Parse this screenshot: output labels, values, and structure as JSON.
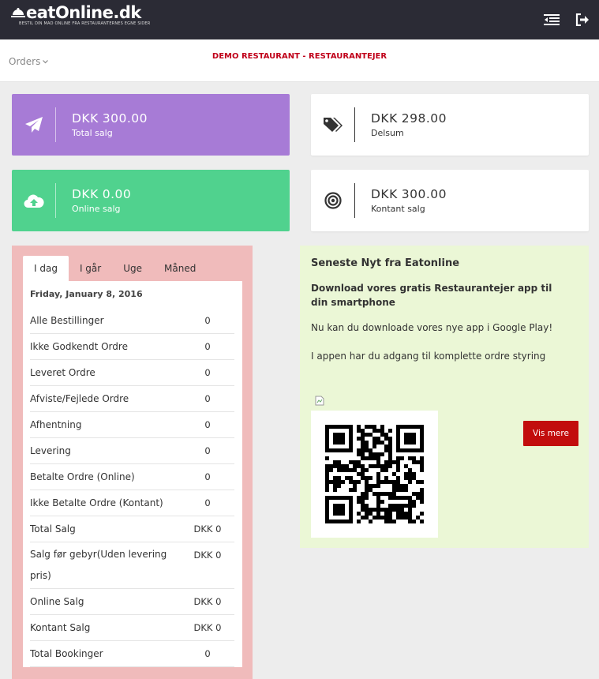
{
  "brand": {
    "logo_text": "eatOnline.dk",
    "tagline": "BESTIL DIN MAD ONLINE FRA RESTAURANTERNES EGNE SIDER"
  },
  "header": {
    "orders_label": "Orders",
    "restaurant": "DEMO RESTAURANT - RESTAURANTEJER",
    "icons": [
      "menu-toggle-icon",
      "logout-icon"
    ]
  },
  "stats": [
    {
      "currency": "DKK",
      "amount": "300.00",
      "label": "Total salg",
      "icon": "paper-plane-icon",
      "color": "#a77bd6"
    },
    {
      "currency": "DKK",
      "amount": "298.00",
      "label": "Delsum",
      "icon": "tags-icon",
      "color": "#ffffff"
    },
    {
      "currency": "DKK",
      "amount": "0.00",
      "label": "Online salg",
      "icon": "cloud-upload-icon",
      "color": "#50d28e"
    },
    {
      "currency": "DKK",
      "amount": "300.00",
      "label": "Kontant salg",
      "icon": "bullseye-icon",
      "color": "#ffffff"
    }
  ],
  "report": {
    "tabs": [
      "I dag",
      "I går",
      "Uge",
      "Måned"
    ],
    "active_tab": "I dag",
    "date": "Friday, January 8, 2016",
    "rows": [
      {
        "label": "Alle Bestillinger",
        "value": "0"
      },
      {
        "label": "Ikke Godkendt Ordre",
        "value": "0"
      },
      {
        "label": "Leveret Ordre",
        "value": "0"
      },
      {
        "label": "Afviste/Fejlede Ordre",
        "value": "0"
      },
      {
        "label": "Afhentning",
        "value": "0"
      },
      {
        "label": "Levering",
        "value": "0"
      },
      {
        "label": "Betalte Ordre (Online)",
        "value": "0"
      },
      {
        "label": "Ikke Betalte Ordre (Kontant)",
        "value": "0"
      },
      {
        "label": "Total Salg",
        "value": "DKK 0"
      },
      {
        "label": "Salg før gebyr(Uden levering pris)",
        "value": "DKK 0"
      },
      {
        "label": "Online Salg",
        "value": "DKK 0"
      },
      {
        "label": "Kontant Salg",
        "value": "DKK 0"
      },
      {
        "label": "Total Bookinger",
        "value": "0"
      }
    ]
  },
  "news": {
    "title": "Seneste Nyt fra Eatonline",
    "headline": "Download vores gratis Restaurantejer app til din smartphone",
    "p1": "Nu kan du downloade vores nye app i Google Play!",
    "p2": "I appen har du adgang til komplette ordre styring",
    "button": "Vis mere"
  },
  "colors": {
    "topbar": "#2b2b35",
    "accent_red": "#c0001a",
    "report_panel": "#f0bbbb",
    "news_panel": "#ebf7d6"
  }
}
